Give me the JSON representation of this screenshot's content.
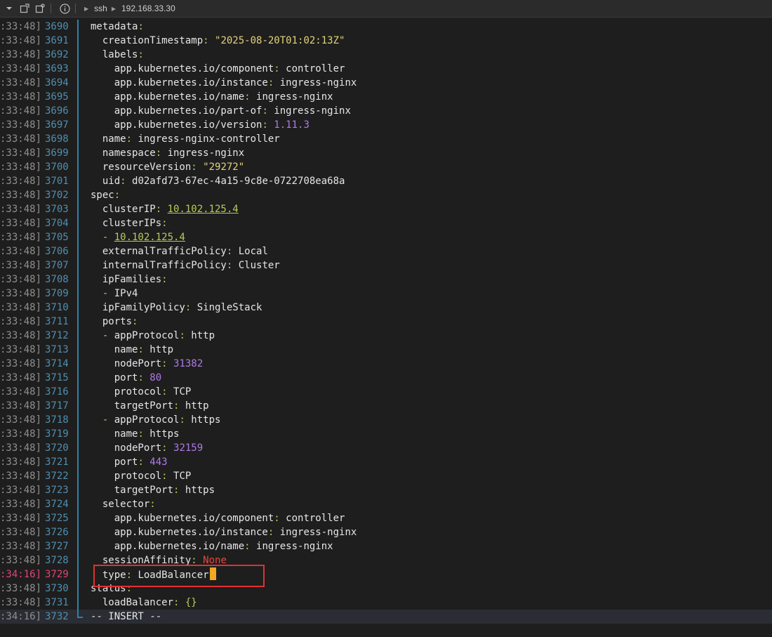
{
  "topbar": {
    "icons": [
      "chevron-down-icon",
      "new-window-icon",
      "duplicate-icon",
      "info-icon"
    ],
    "breadcrumbs": [
      "ssh",
      "192.168.33.30"
    ]
  },
  "colors": {
    "key": "#e6e6e6",
    "punct": "#b5cc5a",
    "string": "#e3d37d",
    "number": "#b07ae6",
    "ip_link": "#b5cc5a",
    "null": "#e8453c",
    "cursor": "#f5a623",
    "highlight": "#e03131"
  },
  "lines": [
    {
      "ts": ":33:48]",
      "n": "3690",
      "indent": 0,
      "key": "metadata",
      "sep": ":",
      "val": "",
      "vtype": ""
    },
    {
      "ts": ":33:48]",
      "n": "3691",
      "indent": 1,
      "key": "creationTimestamp",
      "sep": ": ",
      "val": "\"2025-08-20T01:02:13Z\"",
      "vtype": "s"
    },
    {
      "ts": ":33:48]",
      "n": "3692",
      "indent": 1,
      "key": "labels",
      "sep": ":",
      "val": "",
      "vtype": ""
    },
    {
      "ts": ":33:48]",
      "n": "3693",
      "indent": 2,
      "key": "app.kubernetes.io/component",
      "sep": ": ",
      "val": "controller",
      "vtype": "t"
    },
    {
      "ts": ":33:48]",
      "n": "3694",
      "indent": 2,
      "key": "app.kubernetes.io/instance",
      "sep": ": ",
      "val": "ingress-nginx",
      "vtype": "t"
    },
    {
      "ts": ":33:48]",
      "n": "3695",
      "indent": 2,
      "key": "app.kubernetes.io/name",
      "sep": ": ",
      "val": "ingress-nginx",
      "vtype": "t"
    },
    {
      "ts": ":33:48]",
      "n": "3696",
      "indent": 2,
      "key": "app.kubernetes.io/part-of",
      "sep": ": ",
      "val": "ingress-nginx",
      "vtype": "t"
    },
    {
      "ts": ":33:48]",
      "n": "3697",
      "indent": 2,
      "key": "app.kubernetes.io/version",
      "sep": ": ",
      "val": "1.11.3",
      "vtype": "n"
    },
    {
      "ts": ":33:48]",
      "n": "3698",
      "indent": 1,
      "key": "name",
      "sep": ": ",
      "val": "ingress-nginx-controller",
      "vtype": "t"
    },
    {
      "ts": ":33:48]",
      "n": "3699",
      "indent": 1,
      "key": "namespace",
      "sep": ": ",
      "val": "ingress-nginx",
      "vtype": "t"
    },
    {
      "ts": ":33:48]",
      "n": "3700",
      "indent": 1,
      "key": "resourceVersion",
      "sep": ": ",
      "val": "\"29272\"",
      "vtype": "s"
    },
    {
      "ts": ":33:48]",
      "n": "3701",
      "indent": 1,
      "key": "uid",
      "sep": ": ",
      "val": "d02afd73-67ec-4a15-9c8e-0722708ea68a",
      "vtype": "t"
    },
    {
      "ts": ":33:48]",
      "n": "3702",
      "indent": 0,
      "key": "spec",
      "sep": ":",
      "val": "",
      "vtype": ""
    },
    {
      "ts": ":33:48]",
      "n": "3703",
      "indent": 1,
      "key": "clusterIP",
      "sep": ": ",
      "val": "10.102.125.4",
      "vtype": "u"
    },
    {
      "ts": ":33:48]",
      "n": "3704",
      "indent": 1,
      "key": "clusterIPs",
      "sep": ":",
      "val": "",
      "vtype": ""
    },
    {
      "ts": ":33:48]",
      "n": "3705",
      "indent": 1,
      "dash": true,
      "key": "",
      "sep": "",
      "val": "10.102.125.4",
      "vtype": "u"
    },
    {
      "ts": ":33:48]",
      "n": "3706",
      "indent": 1,
      "key": "externalTrafficPolicy",
      "sep": ": ",
      "val": "Local",
      "vtype": "t"
    },
    {
      "ts": ":33:48]",
      "n": "3707",
      "indent": 1,
      "key": "internalTrafficPolicy",
      "sep": ": ",
      "val": "Cluster",
      "vtype": "t"
    },
    {
      "ts": ":33:48]",
      "n": "3708",
      "indent": 1,
      "key": "ipFamilies",
      "sep": ":",
      "val": "",
      "vtype": ""
    },
    {
      "ts": ":33:48]",
      "n": "3709",
      "indent": 1,
      "dash": true,
      "key": "",
      "sep": "",
      "val": "IPv4",
      "vtype": "t"
    },
    {
      "ts": ":33:48]",
      "n": "3710",
      "indent": 1,
      "key": "ipFamilyPolicy",
      "sep": ": ",
      "val": "SingleStack",
      "vtype": "t"
    },
    {
      "ts": ":33:48]",
      "n": "3711",
      "indent": 1,
      "key": "ports",
      "sep": ":",
      "val": "",
      "vtype": ""
    },
    {
      "ts": ":33:48]",
      "n": "3712",
      "indent": 1,
      "dash": true,
      "key": "appProtocol",
      "sep": ": ",
      "val": "http",
      "vtype": "t"
    },
    {
      "ts": ":33:48]",
      "n": "3713",
      "indent": 2,
      "key": "name",
      "sep": ": ",
      "val": "http",
      "vtype": "t"
    },
    {
      "ts": ":33:48]",
      "n": "3714",
      "indent": 2,
      "key": "nodePort",
      "sep": ": ",
      "val": "31382",
      "vtype": "n"
    },
    {
      "ts": ":33:48]",
      "n": "3715",
      "indent": 2,
      "key": "port",
      "sep": ": ",
      "val": "80",
      "vtype": "n"
    },
    {
      "ts": ":33:48]",
      "n": "3716",
      "indent": 2,
      "key": "protocol",
      "sep": ": ",
      "val": "TCP",
      "vtype": "t"
    },
    {
      "ts": ":33:48]",
      "n": "3717",
      "indent": 2,
      "key": "targetPort",
      "sep": ": ",
      "val": "http",
      "vtype": "t"
    },
    {
      "ts": ":33:48]",
      "n": "3718",
      "indent": 1,
      "dash": true,
      "key": "appProtocol",
      "sep": ": ",
      "val": "https",
      "vtype": "t"
    },
    {
      "ts": ":33:48]",
      "n": "3719",
      "indent": 2,
      "key": "name",
      "sep": ": ",
      "val": "https",
      "vtype": "t"
    },
    {
      "ts": ":33:48]",
      "n": "3720",
      "indent": 2,
      "key": "nodePort",
      "sep": ": ",
      "val": "32159",
      "vtype": "n"
    },
    {
      "ts": ":33:48]",
      "n": "3721",
      "indent": 2,
      "key": "port",
      "sep": ": ",
      "val": "443",
      "vtype": "n"
    },
    {
      "ts": ":33:48]",
      "n": "3722",
      "indent": 2,
      "key": "protocol",
      "sep": ": ",
      "val": "TCP",
      "vtype": "t"
    },
    {
      "ts": ":33:48]",
      "n": "3723",
      "indent": 2,
      "key": "targetPort",
      "sep": ": ",
      "val": "https",
      "vtype": "t"
    },
    {
      "ts": ":33:48]",
      "n": "3724",
      "indent": 1,
      "key": "selector",
      "sep": ":",
      "val": "",
      "vtype": ""
    },
    {
      "ts": ":33:48]",
      "n": "3725",
      "indent": 2,
      "key": "app.kubernetes.io/component",
      "sep": ": ",
      "val": "controller",
      "vtype": "t"
    },
    {
      "ts": ":33:48]",
      "n": "3726",
      "indent": 2,
      "key": "app.kubernetes.io/instance",
      "sep": ": ",
      "val": "ingress-nginx",
      "vtype": "t"
    },
    {
      "ts": ":33:48]",
      "n": "3727",
      "indent": 2,
      "key": "app.kubernetes.io/name",
      "sep": ": ",
      "val": "ingress-nginx",
      "vtype": "t"
    },
    {
      "ts": ":33:48]",
      "n": "3728",
      "indent": 1,
      "key": "sessionAffinity",
      "sep": ": ",
      "val": "None",
      "vtype": "r"
    },
    {
      "ts": ":34:16]",
      "n": "3729",
      "indent": 1,
      "key": "type",
      "sep": ": ",
      "val": "LoadBalancer",
      "vtype": "t",
      "current": true
    },
    {
      "ts": ":33:48]",
      "n": "3730",
      "indent": 0,
      "key": "status",
      "sep": ":",
      "val": "",
      "vtype": ""
    },
    {
      "ts": ":33:48]",
      "n": "3731",
      "indent": 1,
      "key": "loadBalancer",
      "sep": ": ",
      "val": "{}",
      "vtype": "p"
    },
    {
      "ts": ":34:16]",
      "n": "3732",
      "indent": 0,
      "key": "",
      "sep": "",
      "val": "-- INSERT --",
      "vtype": "t",
      "mode": true
    }
  ]
}
